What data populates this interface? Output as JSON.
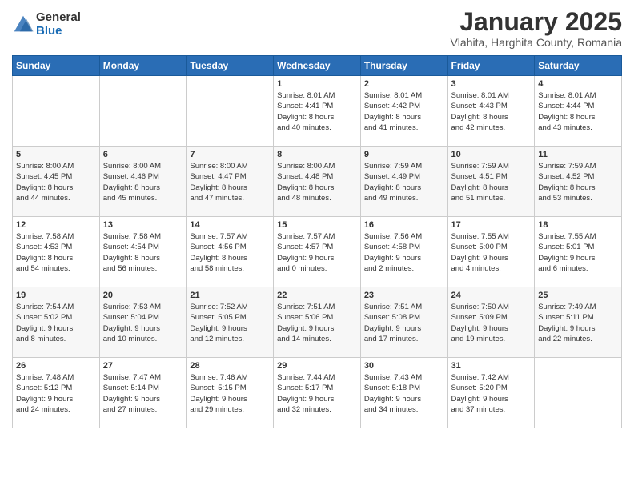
{
  "logo": {
    "general": "General",
    "blue": "Blue"
  },
  "title": "January 2025",
  "subtitle": "Vlahita, Harghita County, Romania",
  "weekdays": [
    "Sunday",
    "Monday",
    "Tuesday",
    "Wednesday",
    "Thursday",
    "Friday",
    "Saturday"
  ],
  "weeks": [
    [
      {
        "num": "",
        "info": ""
      },
      {
        "num": "",
        "info": ""
      },
      {
        "num": "",
        "info": ""
      },
      {
        "num": "1",
        "info": "Sunrise: 8:01 AM\nSunset: 4:41 PM\nDaylight: 8 hours\nand 40 minutes."
      },
      {
        "num": "2",
        "info": "Sunrise: 8:01 AM\nSunset: 4:42 PM\nDaylight: 8 hours\nand 41 minutes."
      },
      {
        "num": "3",
        "info": "Sunrise: 8:01 AM\nSunset: 4:43 PM\nDaylight: 8 hours\nand 42 minutes."
      },
      {
        "num": "4",
        "info": "Sunrise: 8:01 AM\nSunset: 4:44 PM\nDaylight: 8 hours\nand 43 minutes."
      }
    ],
    [
      {
        "num": "5",
        "info": "Sunrise: 8:00 AM\nSunset: 4:45 PM\nDaylight: 8 hours\nand 44 minutes."
      },
      {
        "num": "6",
        "info": "Sunrise: 8:00 AM\nSunset: 4:46 PM\nDaylight: 8 hours\nand 45 minutes."
      },
      {
        "num": "7",
        "info": "Sunrise: 8:00 AM\nSunset: 4:47 PM\nDaylight: 8 hours\nand 47 minutes."
      },
      {
        "num": "8",
        "info": "Sunrise: 8:00 AM\nSunset: 4:48 PM\nDaylight: 8 hours\nand 48 minutes."
      },
      {
        "num": "9",
        "info": "Sunrise: 7:59 AM\nSunset: 4:49 PM\nDaylight: 8 hours\nand 49 minutes."
      },
      {
        "num": "10",
        "info": "Sunrise: 7:59 AM\nSunset: 4:51 PM\nDaylight: 8 hours\nand 51 minutes."
      },
      {
        "num": "11",
        "info": "Sunrise: 7:59 AM\nSunset: 4:52 PM\nDaylight: 8 hours\nand 53 minutes."
      }
    ],
    [
      {
        "num": "12",
        "info": "Sunrise: 7:58 AM\nSunset: 4:53 PM\nDaylight: 8 hours\nand 54 minutes."
      },
      {
        "num": "13",
        "info": "Sunrise: 7:58 AM\nSunset: 4:54 PM\nDaylight: 8 hours\nand 56 minutes."
      },
      {
        "num": "14",
        "info": "Sunrise: 7:57 AM\nSunset: 4:56 PM\nDaylight: 8 hours\nand 58 minutes."
      },
      {
        "num": "15",
        "info": "Sunrise: 7:57 AM\nSunset: 4:57 PM\nDaylight: 9 hours\nand 0 minutes."
      },
      {
        "num": "16",
        "info": "Sunrise: 7:56 AM\nSunset: 4:58 PM\nDaylight: 9 hours\nand 2 minutes."
      },
      {
        "num": "17",
        "info": "Sunrise: 7:55 AM\nSunset: 5:00 PM\nDaylight: 9 hours\nand 4 minutes."
      },
      {
        "num": "18",
        "info": "Sunrise: 7:55 AM\nSunset: 5:01 PM\nDaylight: 9 hours\nand 6 minutes."
      }
    ],
    [
      {
        "num": "19",
        "info": "Sunrise: 7:54 AM\nSunset: 5:02 PM\nDaylight: 9 hours\nand 8 minutes."
      },
      {
        "num": "20",
        "info": "Sunrise: 7:53 AM\nSunset: 5:04 PM\nDaylight: 9 hours\nand 10 minutes."
      },
      {
        "num": "21",
        "info": "Sunrise: 7:52 AM\nSunset: 5:05 PM\nDaylight: 9 hours\nand 12 minutes."
      },
      {
        "num": "22",
        "info": "Sunrise: 7:51 AM\nSunset: 5:06 PM\nDaylight: 9 hours\nand 14 minutes."
      },
      {
        "num": "23",
        "info": "Sunrise: 7:51 AM\nSunset: 5:08 PM\nDaylight: 9 hours\nand 17 minutes."
      },
      {
        "num": "24",
        "info": "Sunrise: 7:50 AM\nSunset: 5:09 PM\nDaylight: 9 hours\nand 19 minutes."
      },
      {
        "num": "25",
        "info": "Sunrise: 7:49 AM\nSunset: 5:11 PM\nDaylight: 9 hours\nand 22 minutes."
      }
    ],
    [
      {
        "num": "26",
        "info": "Sunrise: 7:48 AM\nSunset: 5:12 PM\nDaylight: 9 hours\nand 24 minutes."
      },
      {
        "num": "27",
        "info": "Sunrise: 7:47 AM\nSunset: 5:14 PM\nDaylight: 9 hours\nand 27 minutes."
      },
      {
        "num": "28",
        "info": "Sunrise: 7:46 AM\nSunset: 5:15 PM\nDaylight: 9 hours\nand 29 minutes."
      },
      {
        "num": "29",
        "info": "Sunrise: 7:44 AM\nSunset: 5:17 PM\nDaylight: 9 hours\nand 32 minutes."
      },
      {
        "num": "30",
        "info": "Sunrise: 7:43 AM\nSunset: 5:18 PM\nDaylight: 9 hours\nand 34 minutes."
      },
      {
        "num": "31",
        "info": "Sunrise: 7:42 AM\nSunset: 5:20 PM\nDaylight: 9 hours\nand 37 minutes."
      },
      {
        "num": "",
        "info": ""
      }
    ]
  ]
}
